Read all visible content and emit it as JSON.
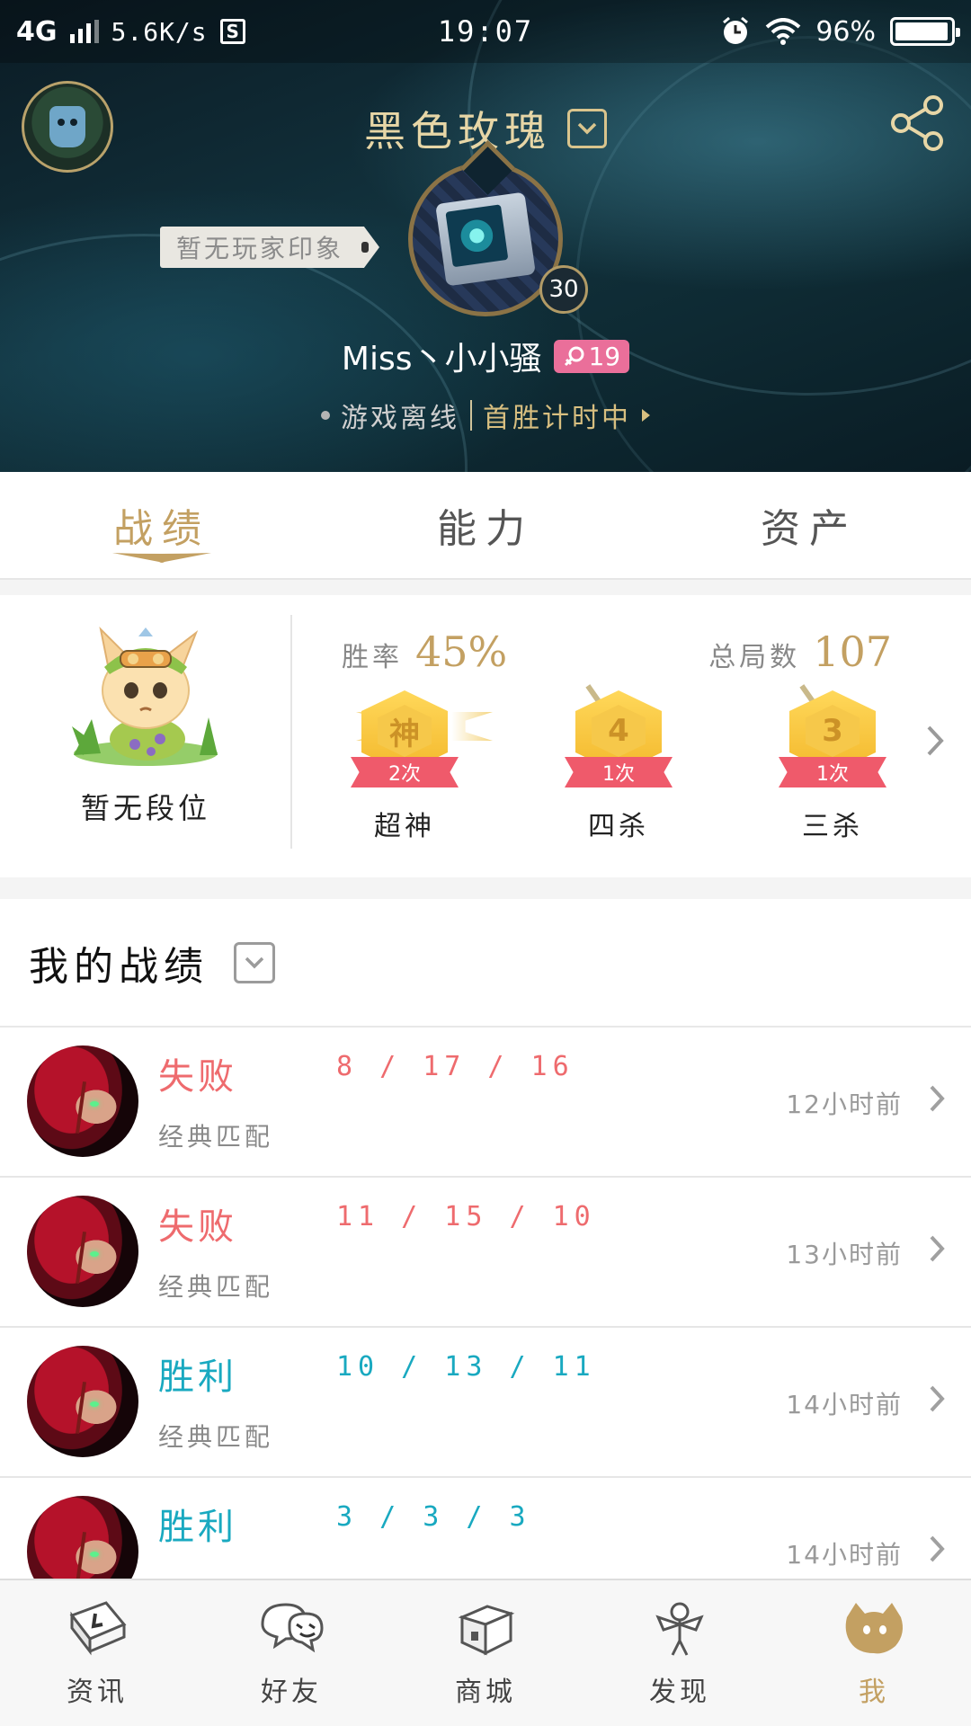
{
  "status_bar": {
    "network": "4G",
    "speed": "5.6K/s",
    "time": "19:07",
    "battery": "96%",
    "battery_level": 0.96
  },
  "header": {
    "title": "黑色玫瑰",
    "impression": "暂无玩家印象",
    "level": "30",
    "player_name": "Miss丶小小骚",
    "rank_badge": "19",
    "online_status": "游戏离线",
    "first_win": "首胜计时中"
  },
  "tabs": [
    {
      "label": "战绩",
      "active": true
    },
    {
      "label": "能力",
      "active": false
    },
    {
      "label": "资产",
      "active": false
    }
  ],
  "stats": {
    "rank_label": "暂无段位",
    "winrate_label": "胜率",
    "winrate_value": "45%",
    "total_label": "总局数",
    "total_value": "107",
    "medals": [
      {
        "glyph": "神",
        "count": "2次",
        "name": "超神"
      },
      {
        "glyph": "4",
        "count": "1次",
        "name": "四杀"
      },
      {
        "glyph": "3",
        "count": "1次",
        "name": "三杀"
      }
    ]
  },
  "records": {
    "title": "我的战绩",
    "matches": [
      {
        "result": "失败",
        "kda": "8 / 17 / 16",
        "mode": "经典匹配",
        "time": "12小时前",
        "outcome": "loss"
      },
      {
        "result": "失败",
        "kda": "11 / 15 / 10",
        "mode": "经典匹配",
        "time": "13小时前",
        "outcome": "loss"
      },
      {
        "result": "胜利",
        "kda": "10 / 13 / 11",
        "mode": "经典匹配",
        "time": "14小时前",
        "outcome": "win"
      },
      {
        "result": "胜利",
        "kda": "3 / 3 / 3",
        "mode": "",
        "time": "14小时前",
        "outcome": "win"
      }
    ]
  },
  "bottom_nav": [
    {
      "label": "资讯",
      "icon": "news-icon",
      "active": false
    },
    {
      "label": "好友",
      "icon": "friends-icon",
      "active": false
    },
    {
      "label": "商城",
      "icon": "shop-icon",
      "active": false
    },
    {
      "label": "发现",
      "icon": "discover-icon",
      "active": false
    },
    {
      "label": "我",
      "icon": "me-icon",
      "active": true
    }
  ],
  "colors": {
    "accent_gold": "#c3a062",
    "loss_red": "#ee6b6e",
    "win_teal": "#19a9c0",
    "rank_pink": "#ea6f9a"
  }
}
